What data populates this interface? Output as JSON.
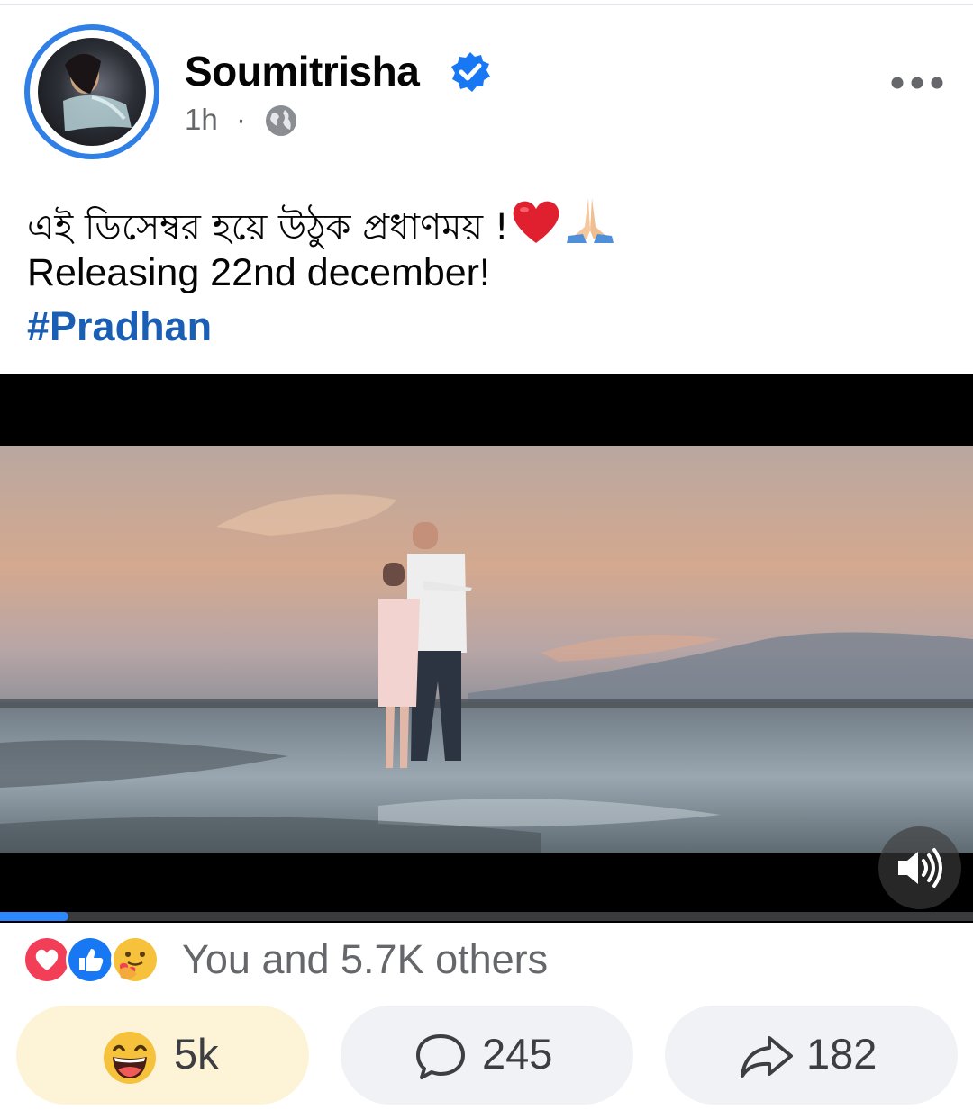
{
  "post": {
    "author": "Soumitrisha",
    "time": "1h",
    "separator": "·",
    "caption_bn": "এই ডিসেম্বর হয়ে উঠুক প্রধাণময় !",
    "caption_en": "Releasing 22nd december!",
    "hashtag": "#Pradhan"
  },
  "video": {
    "progress_fraction": 0.07
  },
  "reactions": {
    "summary": "You and 5.7K others",
    "icons": [
      "love-reaction-icon",
      "like-reaction-icon",
      "care-reaction-icon"
    ]
  },
  "actions": {
    "react_count": "5k",
    "comment_count": "245",
    "share_count": "182"
  },
  "colors": {
    "verified": "#1877f2",
    "hashtag": "#1a5fb4",
    "progress": "#2d88ff",
    "react_pill": "#fdf4d8"
  }
}
